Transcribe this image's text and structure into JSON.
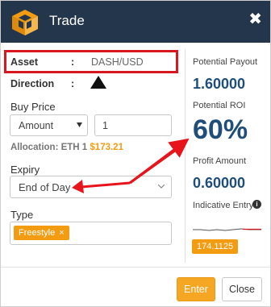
{
  "window": {
    "title": "Trade",
    "close_glyph": "✖"
  },
  "form": {
    "asset_label": "Asset",
    "asset_colon": ":",
    "asset_value": "DASH/USD",
    "direction_label": "Direction",
    "direction_colon": ":",
    "buy_price_label": "Buy Price",
    "amount_select": "Amount",
    "buy_price_value": "1",
    "allocation_label": "Allocation: ETH 1",
    "allocation_value": "$173.21",
    "expiry_label": "Expiry",
    "expiry_value": "End of Day",
    "type_label": "Type",
    "type_tag": "Freestyle",
    "type_tag_remove": "×"
  },
  "summary": {
    "payout_label": "Potential Payout",
    "payout_value": "1.60000",
    "roi_label": "Potential ROI",
    "roi_value": "60%",
    "profit_label": "Profit Amount",
    "profit_value": "0.60000",
    "indicative_label": "Indicative Entry",
    "info_glyph": "i",
    "indicative_value": "174.1125"
  },
  "footer": {
    "enter_label": "Enter",
    "close_label": "Close"
  },
  "colors": {
    "header_bg": "#24364b",
    "accent": "#f39c12",
    "value_blue": "#1f4e7a",
    "highlight_red": "#d7181f"
  },
  "icons": {
    "logo": "cube-logo-icon",
    "direction": "triangle-up-icon",
    "info": "info-circle-icon"
  }
}
